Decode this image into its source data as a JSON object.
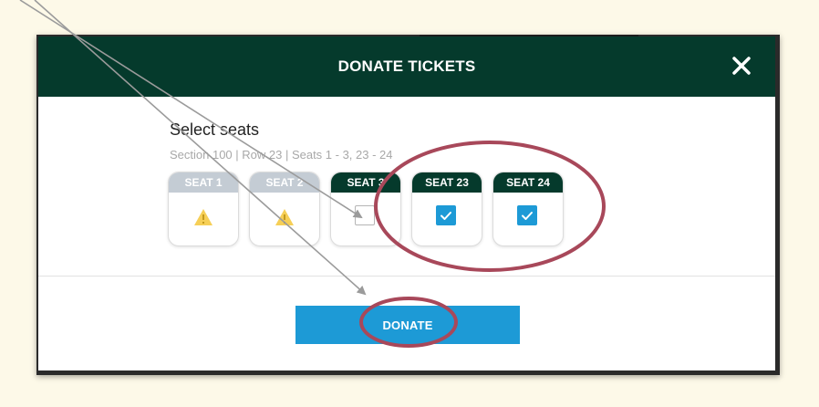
{
  "modal": {
    "title": "DONATE TICKETS",
    "close_icon": "close-icon",
    "select_title": "Select seats",
    "seat_info": "Section 100 | Row 23 | Seats 1 - 3, 23 - 24",
    "seats": [
      {
        "label": "SEAT 1",
        "state": "unavailable",
        "icon": "warning-icon"
      },
      {
        "label": "SEAT 2",
        "state": "unavailable",
        "icon": "warning-icon"
      },
      {
        "label": "SEAT 3",
        "state": "unchecked",
        "icon": "checkbox-icon"
      },
      {
        "label": "SEAT 23",
        "state": "checked",
        "icon": "checkbox-checked-icon"
      },
      {
        "label": "SEAT 24",
        "state": "checked",
        "icon": "checkbox-checked-icon"
      }
    ],
    "donate_label": "DONATE"
  },
  "colors": {
    "header_bg": "#053a2c",
    "accent_blue": "#1d9ad6",
    "disabled_label": "#c4ccd4",
    "warning_yellow": "#f6cf57",
    "annotation_red": "#a8485a",
    "annotation_arrow": "#9b9b9b"
  }
}
